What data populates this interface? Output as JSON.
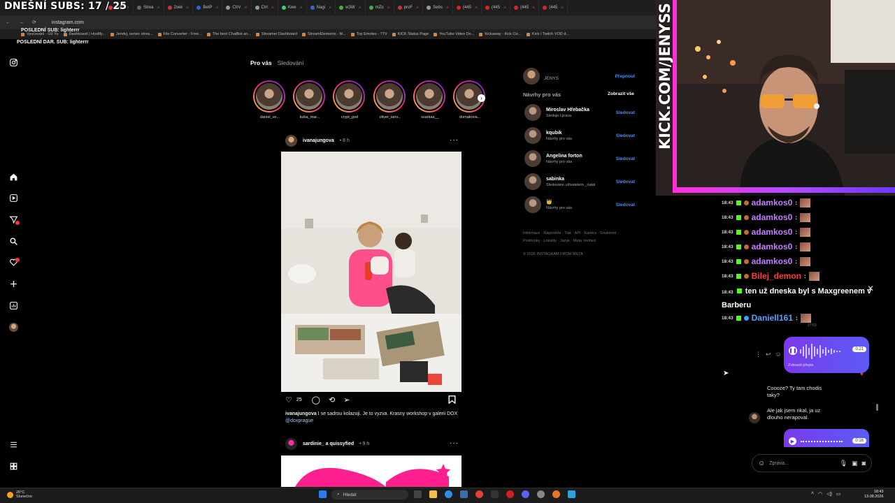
{
  "overlay": {
    "subs_counter": "DNEŠNÍ SUBS: 17 / 25",
    "last_sub": "POSLEDNÍ SUB: lighterrr",
    "last_dar": "POSLEDNÍ DAR. SUB: lighterrr",
    "kick_url": "KICK.COM/JENYSS"
  },
  "browser": {
    "tabs": [
      {
        "label": "Nejlí"
      },
      {
        "label": "Strea"
      },
      {
        "label": "2sek"
      },
      {
        "label": "BetP"
      },
      {
        "label": "CtrV"
      },
      {
        "label": "Ctrl"
      },
      {
        "label": "Kwe"
      },
      {
        "label": "Nagi"
      },
      {
        "label": "w3W"
      },
      {
        "label": "mZo"
      },
      {
        "label": "proF"
      },
      {
        "label": "Sebs"
      },
      {
        "label": "(445"
      },
      {
        "label": "(445"
      },
      {
        "label": "(445"
      },
      {
        "label": "(445"
      }
    ],
    "url": "instagram.com",
    "bookmarks": [
      {
        "label": "Vyučování - O2 Yu"
      },
      {
        "label": "Dashboard | Hostify..."
      },
      {
        "label": "Jendvj, server strea..."
      },
      {
        "label": "File Converter - Free..."
      },
      {
        "label": "The best ChatBot an..."
      },
      {
        "label": "Streamer Dashboard"
      },
      {
        "label": "StreamElements - M..."
      },
      {
        "label": "Top Emotes - 7TV"
      },
      {
        "label": "KICK Status Page"
      },
      {
        "label": "YouTube Video Do..."
      },
      {
        "label": "Kickaway - Kick Cic..."
      },
      {
        "label": "Kick / Twitch VOD d..."
      }
    ]
  },
  "nav": {
    "notification_count": "4"
  },
  "feed": {
    "tab_for_you": "Pro vás",
    "tab_following": "Sledování",
    "stories": [
      {
        "name": "daniel_ve..."
      },
      {
        "name": "kuba_mar..."
      },
      {
        "name": "crypt_god"
      },
      {
        "name": "oliver_sarv..."
      },
      {
        "name": "ssarkaa__"
      },
      {
        "name": "dornakova..."
      }
    ],
    "post1": {
      "user": "ivanajungova",
      "time": "• 8 h",
      "likes": "25",
      "caption_user": "ivanajungova",
      "caption_text": " I se sadrou kolazuji. Je to vyzva. Krasny workshop v galerii DOX ",
      "caption_tag": "@doxprague"
    },
    "post2": {
      "user": "sardinie_ a quissyfied",
      "time": "• 9 h"
    }
  },
  "sidebar": {
    "account_user": "JENYS",
    "switch_label": "Přepnout",
    "suggestions_title": "Návrhy pro vás",
    "see_all": "Zobrazit vše",
    "suggestions": [
      {
        "name": "Miroslav Hřebačka",
        "sub": "Sleduje t.jirava",
        "follow": "Sledovat"
      },
      {
        "name": "kqubik",
        "sub": "Návrhy pro vás",
        "follow": "Sledovat"
      },
      {
        "name": "Angelina forton",
        "sub": "Návrhy pro vás",
        "follow": "Sledovat"
      },
      {
        "name": "sabinka",
        "sub": "Sledováno uživatelem _natal",
        "follow": "Sledovat"
      },
      {
        "name": "👑",
        "sub": "Návrhy pro vás",
        "follow": "Sledovat"
      }
    ],
    "footer_line1": "Informace · Nápověda · Tisk · API · Kariéra · Soukromí ·",
    "footer_line2": "Podmínky · Lokality · Jazyk · Meta Verified",
    "copyright": "© 2026 INSTAGRAM FROM META"
  },
  "chat": {
    "messages": [
      {
        "time": "18:43",
        "user": "adamkos0",
        "color": "#c77dff"
      },
      {
        "time": "18:43",
        "user": "adamkos0",
        "color": "#c77dff"
      },
      {
        "time": "18:43",
        "user": "adamkos0",
        "color": "#c77dff"
      },
      {
        "time": "18:43",
        "user": "adamkos0",
        "color": "#c77dff"
      },
      {
        "time": "18:43",
        "user": "adamkos0",
        "color": "#c77dff"
      },
      {
        "time": "18:43",
        "user": "Bilej_demon",
        "color": "#ff3b3b"
      }
    ],
    "big_message_time": "18:43",
    "big_message": "ten už dneska byl s Maxgreenem v Barberu",
    "last_message_time": "18:43",
    "last_message_user": "Daniell161",
    "last_message_color": "#5aa0ff"
  },
  "dm": {
    "voice1_duration": "0:21",
    "voice1_transcript": "Zobrazit přepis",
    "timestamp": "17:53",
    "msg1": "Coooze? Ty tam chodis taky?",
    "msg2": "Ale jak jsem rikal, ja uz dlouho nerapoval.",
    "voice2_duration": "0:16",
    "input_placeholder": "Zpráva..."
  },
  "taskbar": {
    "weather_temp": "26°C",
    "weather_desc": "Slunečno",
    "search": "Hledat",
    "time": "18:43",
    "date": "13.08.2026"
  }
}
